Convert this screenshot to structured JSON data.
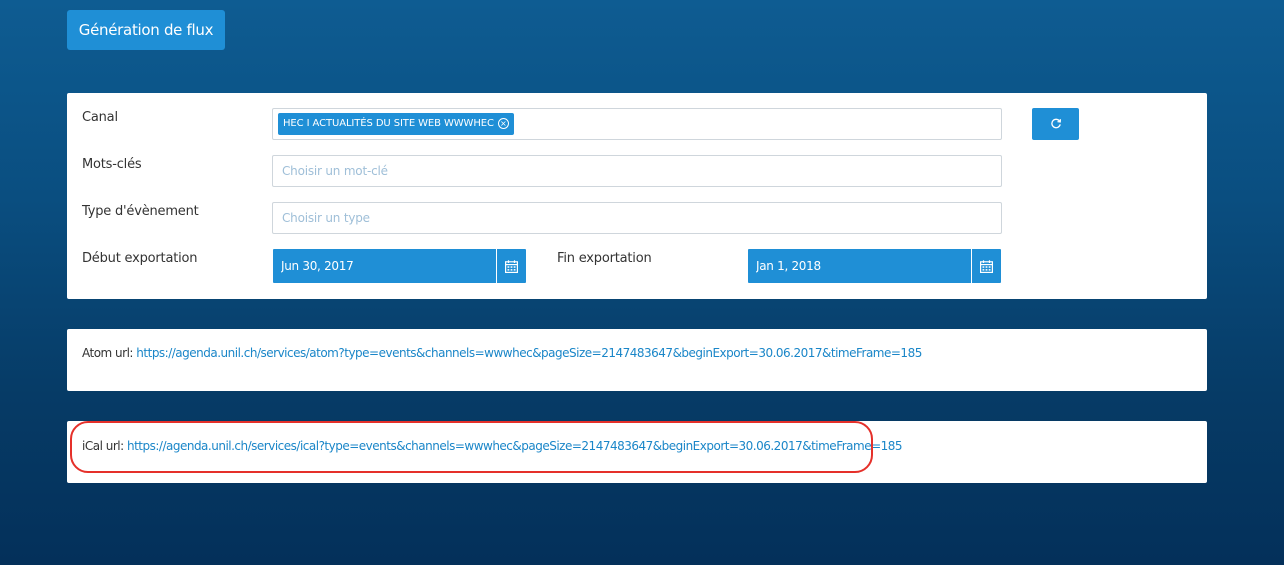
{
  "header": {
    "generate_button_label": "Génération de flux"
  },
  "form": {
    "canal": {
      "label": "Canal",
      "selected_tag": "HEC I ACTUALITÉS DU SITE WEB WWWHEC",
      "remove_glyph": "×"
    },
    "keywords": {
      "label": "Mots-clés",
      "placeholder": "Choisir un mot-clé",
      "value": ""
    },
    "event_type": {
      "label": "Type d'évènement",
      "placeholder": "Choisir un type",
      "value": ""
    },
    "export_start": {
      "label": "Début exportation",
      "value": "Jun 30, 2017"
    },
    "export_end": {
      "label": "Fin exportation",
      "value": "Jan 1, 2018"
    },
    "refresh_icon": "refresh-icon",
    "calendar_icon": "calendar-icon"
  },
  "atom": {
    "label": "Atom url:",
    "url": "https://agenda.unil.ch/services/atom?type=events&channels=wwwhec&pageSize=2147483647&beginExport=30.06.2017&timeFrame=185"
  },
  "ical": {
    "label": "iCal url:",
    "url": "https://agenda.unil.ch/services/ical?type=events&channels=wwwhec&pageSize=2147483647&beginExport=30.06.2017&timeFrame=185"
  },
  "colors": {
    "accent": "#1f8fd6",
    "link": "#1a86c8",
    "highlight": "#e5302a",
    "background_top": "#0e5c92",
    "background_bottom": "#04305a"
  }
}
